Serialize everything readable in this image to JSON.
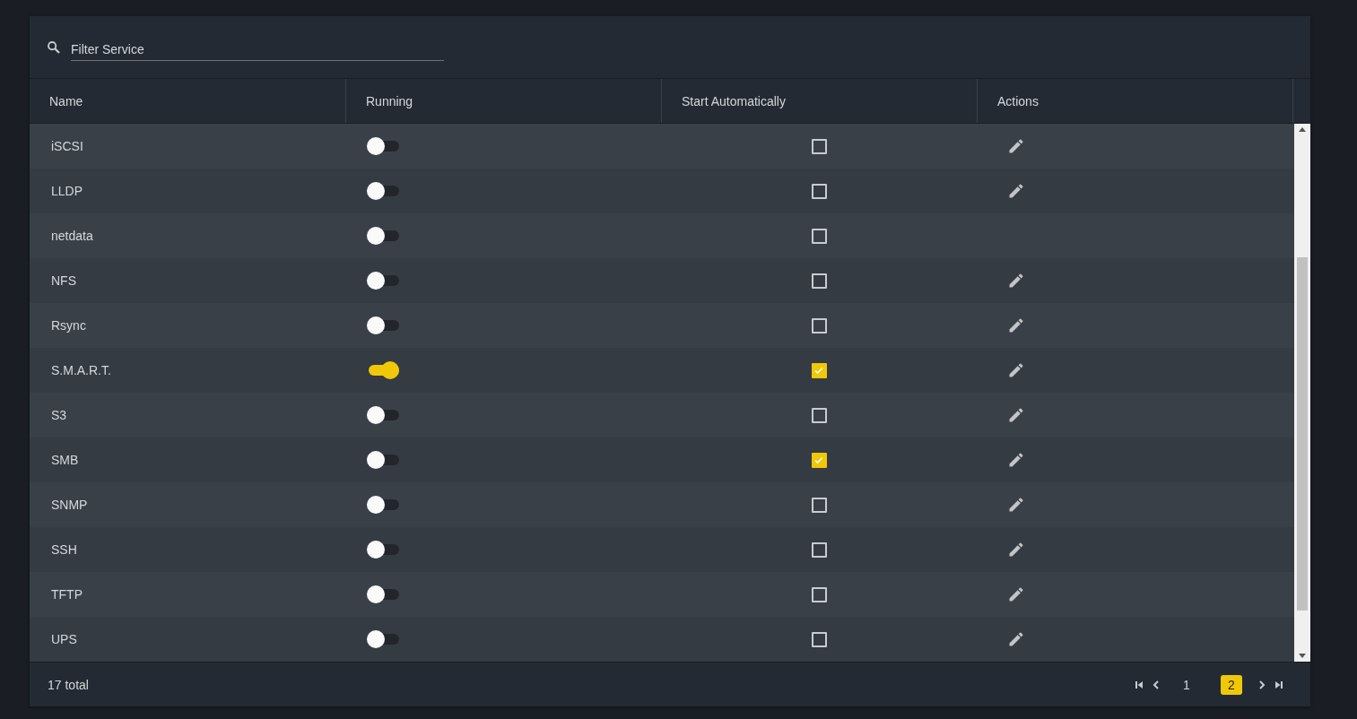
{
  "filter": {
    "placeholder": "Filter Service"
  },
  "columns": [
    "Name",
    "Running",
    "Start Automatically",
    "Actions"
  ],
  "rows": [
    {
      "name": "iSCSI",
      "running": false,
      "start_automatically": false,
      "editable": true
    },
    {
      "name": "LLDP",
      "running": false,
      "start_automatically": false,
      "editable": true
    },
    {
      "name": "netdata",
      "running": false,
      "start_automatically": false,
      "editable": false
    },
    {
      "name": "NFS",
      "running": false,
      "start_automatically": false,
      "editable": true
    },
    {
      "name": "Rsync",
      "running": false,
      "start_automatically": false,
      "editable": true
    },
    {
      "name": "S.M.A.R.T.",
      "running": true,
      "start_automatically": true,
      "editable": true
    },
    {
      "name": "S3",
      "running": false,
      "start_automatically": false,
      "editable": true
    },
    {
      "name": "SMB",
      "running": false,
      "start_automatically": true,
      "editable": true
    },
    {
      "name": "SNMP",
      "running": false,
      "start_automatically": false,
      "editable": true
    },
    {
      "name": "SSH",
      "running": false,
      "start_automatically": false,
      "editable": true
    },
    {
      "name": "TFTP",
      "running": false,
      "start_automatically": false,
      "editable": true
    },
    {
      "name": "UPS",
      "running": false,
      "start_automatically": false,
      "editable": true
    }
  ],
  "footer": {
    "total": "17 total",
    "pages": [
      {
        "label": "1",
        "selected": false
      },
      {
        "label": "2",
        "selected": true
      }
    ]
  }
}
